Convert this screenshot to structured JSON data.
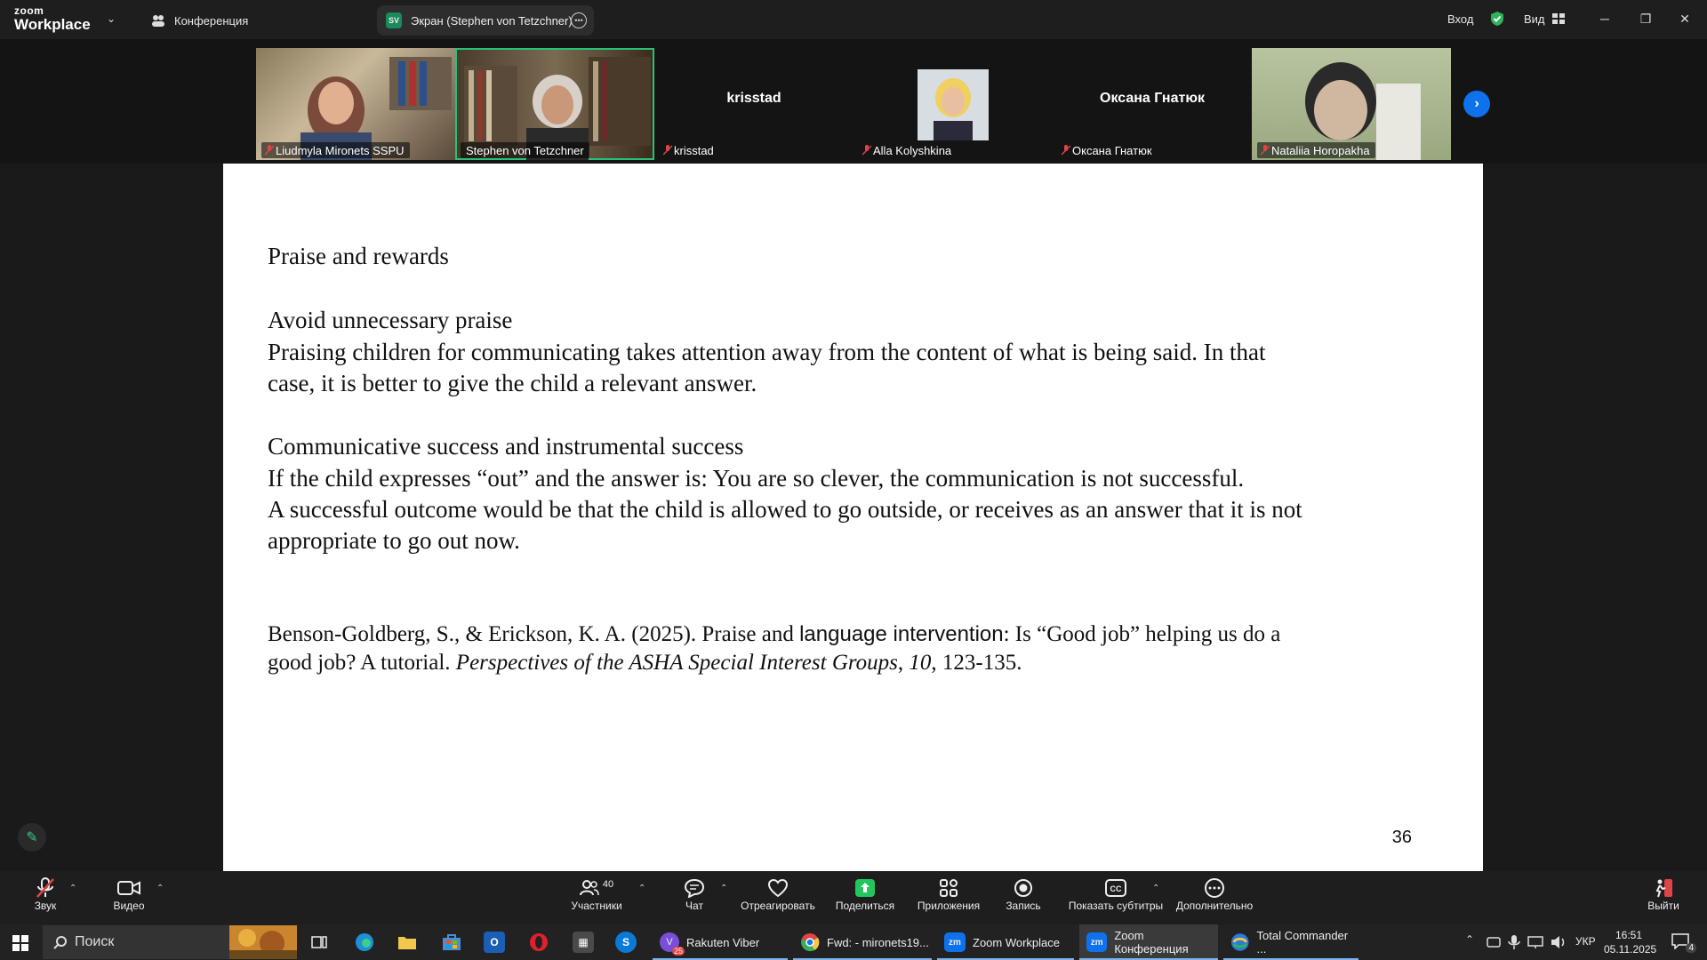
{
  "titlebar": {
    "logo_small": "zoom",
    "logo_big": "Workplace",
    "meeting_tab": "Конференция",
    "share_badge": "SV",
    "share_tab": "Экран (Stephen von Tetzchner)",
    "signin": "Вход",
    "view": "Вид"
  },
  "gallery": {
    "tiles": [
      {
        "name": "Liudmyla Mironets SSPU",
        "center": ""
      },
      {
        "name": "Stephen von Tetzchner",
        "center": ""
      },
      {
        "name": "krisstad",
        "center": "krisstad"
      },
      {
        "name": "Alla Kolyshkina",
        "center": ""
      },
      {
        "name": "Оксана Гнатюк",
        "center": "Оксана Гнатюк"
      },
      {
        "name": "Nataliia Horopakha",
        "center": ""
      }
    ]
  },
  "slide": {
    "heading": "Praise and rewards",
    "sub1": "Avoid unnecessary praise",
    "p1_line1": "Praising children for communicating takes attention away from the content of what is being said. In that",
    "p1_line2": "case, it is better to give the child a relevant answer.",
    "sub2": "Communicative success and instrumental success",
    "p2_line1": "If the child expresses “out” and the answer is: You are so clever, the communication is not successful.",
    "p2_line2": "A successful outcome would be that the child is allowed to go outside, or receives as an answer that it is not",
    "p2_line3": "appropriate to go out now.",
    "ref_line1_a": "Benson-Goldberg, S., & Erickson, K. A. (2025). Praise and ",
    "ref_line1_b": "language intervention",
    "ref_line1_c": ": Is “Good job” helping us do a",
    "ref_line2_a": "good job? A tutorial. ",
    "ref_line2_b": "Perspectives of the ASHA Special Interest Groups",
    "ref_line2_c": ", ",
    "ref_line2_d": "10",
    "ref_line2_e": ", 123-135.",
    "page_number": "36"
  },
  "toolbar": {
    "audio": "Звук",
    "video": "Видео",
    "participants": "Участники",
    "participants_count": "40",
    "chat": "Чат",
    "react": "Отреагировать",
    "share": "Поделиться",
    "apps": "Приложения",
    "record": "Запись",
    "captions": "Показать субтитры",
    "more": "Дополнительно",
    "leave": "Выйти"
  },
  "taskbar": {
    "search": "Поиск",
    "viber": "Rakuten Viber",
    "viber_badge": "25",
    "chrome": "Fwd: - mironets19...",
    "zoom_workplace": "Zoom Workplace",
    "zoom_meeting": "Zoom Конференция",
    "total_commander": "Total Commander ...",
    "lang": "УКР",
    "time": "16:51",
    "date": "05.11.2025",
    "notifications": "4"
  }
}
